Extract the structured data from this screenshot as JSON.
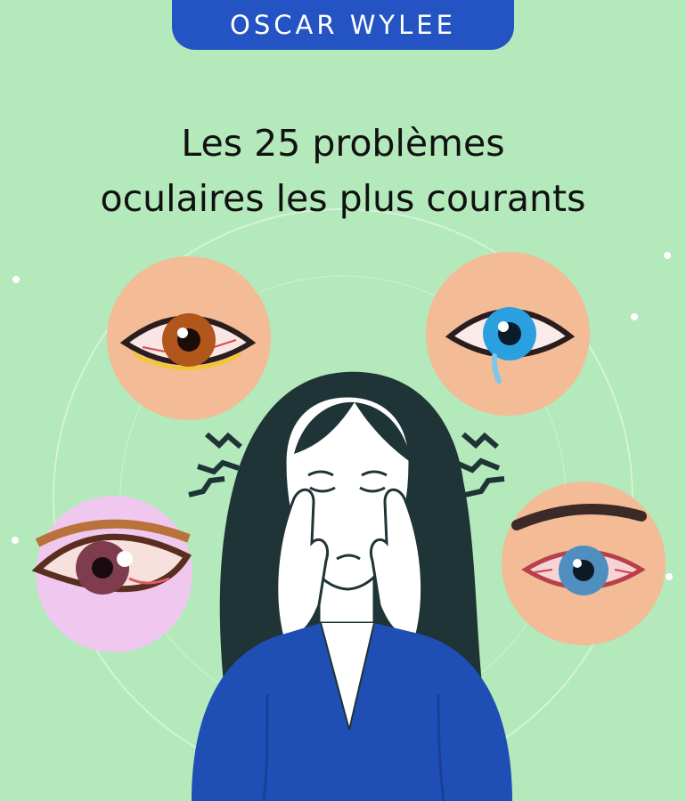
{
  "brand": {
    "logo_text": "OSCAR WYLEE"
  },
  "headline": {
    "line1": "Les 25 problèmes",
    "line2": "oculaires les plus courants"
  },
  "illustration": {
    "icons": [
      "red-eye-brown-icon",
      "teary-blue-eye-icon",
      "pink-eye-icon",
      "bloodshot-blue-eye-icon",
      "stress-zigzag-icon"
    ],
    "colors": {
      "background": "#b3e9bb",
      "brand_blue": "#2453c4",
      "hair": "#1f3436",
      "sweater": "#1f4fb5",
      "skin_circle": "#f3bb96"
    }
  }
}
